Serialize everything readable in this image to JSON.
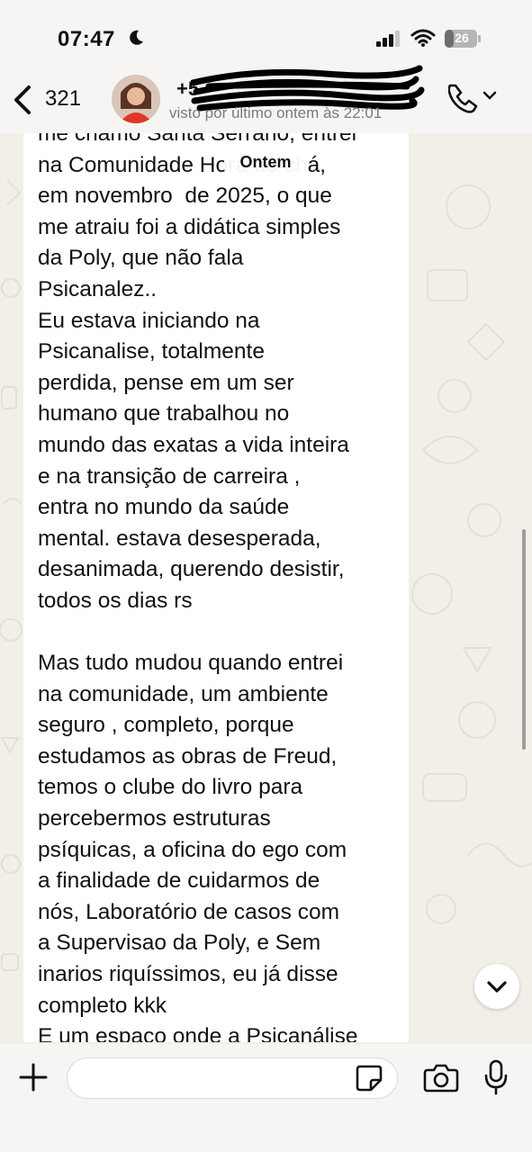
{
  "status_bar": {
    "time": "07:47",
    "battery": "26"
  },
  "header": {
    "back_count": "321",
    "contact_name": "+5",
    "last_seen": "visto por último ontem às 22:01"
  },
  "date_chip": "Ontem",
  "message": {
    "lines": [
      "me chamo Sarita Serrano, entrei",
      "na Comunidade Hora do chá,",
      "em novembro  de 2025, o que",
      "me atraiu foi a didática simples",
      "da Poly, que não fala",
      "Psicanalez..",
      "Eu estava iniciando na",
      "Psicanalise, totalmente",
      "perdida, pense em um ser",
      "humano que trabalhou no",
      "mundo das exatas a vida inteira",
      "e na transição de carreira ,",
      "entra no mundo da saúde",
      "mental. estava desesperada,",
      "desanimada, querendo desistir,",
      "todos os dias rs",
      "",
      "Mas tudo mudou quando entrei",
      "na comunidade, um ambiente",
      "seguro , completo, porque",
      "estudamos as obras de Freud,",
      "temos o clube do livro para",
      "percebermos estruturas",
      "psíquicas, a oficina do ego com",
      "a finalidade de cuidarmos de",
      "nós, Laboratório de casos com",
      "a Supervisao da Poly, e Sem",
      "inarios riquíssimos, eu já disse",
      "completo kkk",
      "E um espaço onde a Psicanálise"
    ]
  },
  "input": {
    "placeholder": "",
    "value": ""
  },
  "icons": {
    "back": "chevron-left-icon",
    "call": "phone-icon",
    "plus": "plus-icon",
    "sticker": "sticker-icon",
    "camera": "camera-icon",
    "mic": "microphone-icon",
    "scroll_down": "chevron-down-icon"
  },
  "colors": {
    "accent": "#111111",
    "chat_background": "#f2efe9",
    "bubble": "#ffffff"
  }
}
